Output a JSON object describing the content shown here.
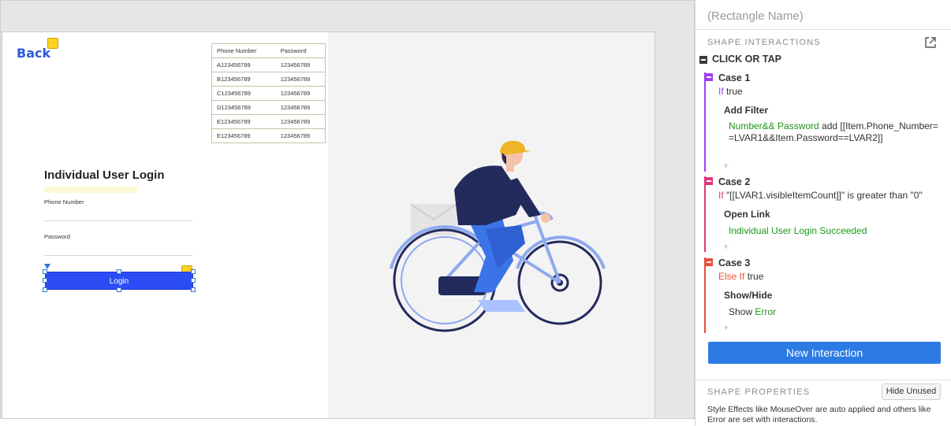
{
  "canvas": {
    "back_label": "Back",
    "bolt_glyph": "⚡",
    "table": {
      "headers": [
        "Phone Number",
        "Password"
      ],
      "rows": [
        [
          "A123456789",
          "123456789"
        ],
        [
          "B123456789",
          "123456789"
        ],
        [
          "C123456789",
          "123456789"
        ],
        [
          "D123456789",
          "123456789"
        ],
        [
          "E123456789",
          "123456789"
        ],
        [
          "E123456789",
          "123456789"
        ]
      ]
    },
    "login_title": "Individual User Login",
    "phone_label": "Phone Number",
    "password_label": "Password",
    "login_button": "Login",
    "illustration_icon": "cyclist-illustration"
  },
  "panel": {
    "shape_name": "(Rectangle Name)",
    "interactions_header": "SHAPE INTERACTIONS",
    "event": "CLICK OR TAP",
    "case1": {
      "title": "Case 1",
      "cond_kw": "If",
      "cond_rest": " true",
      "action_title": "Add Filter",
      "action_green": "Number&& Password",
      "action_rest": " add [[Item.Phone_Number==LVAR1&&Item.Password==LVAR2]]"
    },
    "case2": {
      "title": "Case 2",
      "cond_kw": "If",
      "cond_rest": " \"[[LVAR1.visibleItemCount]]\" is greater than \"0\"",
      "action_title": "Open Link",
      "action_green": "Individual User Login Succeeded"
    },
    "case3": {
      "title": "Case 3",
      "cond_kw": "Else If",
      "cond_rest": " true",
      "action_title": "Show/Hide",
      "action_prefix": "Show ",
      "action_green": "Error"
    },
    "plus": "+",
    "new_interaction": "New Interaction",
    "properties_header": "SHAPE PROPERTIES",
    "hide_unused": "Hide Unused",
    "style_note": "Style Effects like MouseOver are auto applied and others like Error are set with interactions."
  },
  "colors": {
    "accent_blue": "#2c7be5",
    "login_blue": "#2b4cf5",
    "case1": "#a43ef2",
    "case2": "#e0387a",
    "case3": "#e94e3a",
    "green": "#1a9a16"
  }
}
